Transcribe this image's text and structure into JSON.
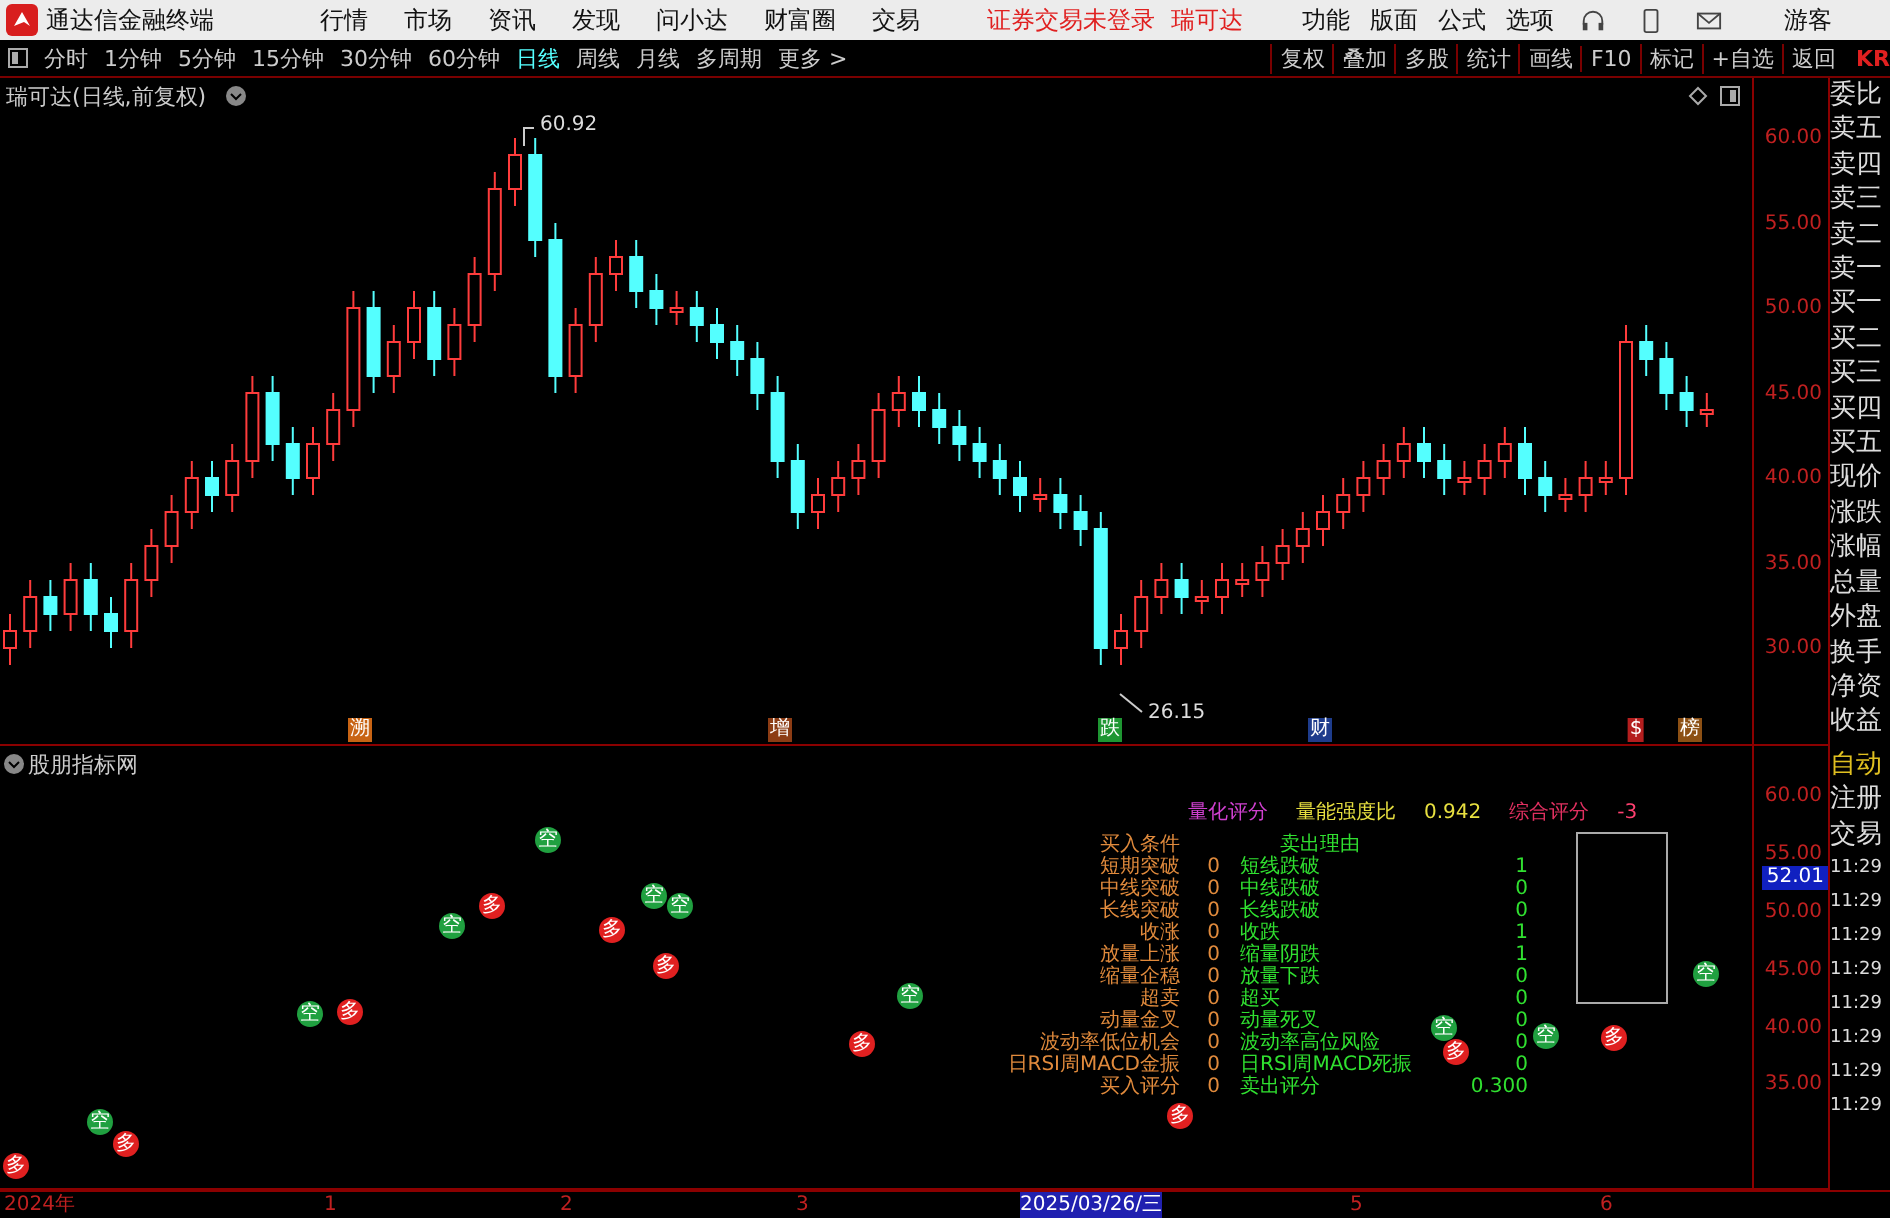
{
  "menu_bar": {
    "app_title": "通达信金融终端",
    "items": [
      "行情",
      "市场",
      "资讯",
      "发现",
      "问小达",
      "财富圈",
      "交易"
    ],
    "notice": "证券交易未登录",
    "stock_name": "瑞可达",
    "right_items": [
      "功能",
      "版面",
      "公式",
      "选项"
    ],
    "user": "游客"
  },
  "toolbar": {
    "periods": [
      {
        "label": "分时",
        "selected": false
      },
      {
        "label": "1分钟",
        "selected": false
      },
      {
        "label": "5分钟",
        "selected": false
      },
      {
        "label": "15分钟",
        "selected": false
      },
      {
        "label": "30分钟",
        "selected": false
      },
      {
        "label": "60分钟",
        "selected": false
      },
      {
        "label": "日线",
        "selected": true
      },
      {
        "label": "周线",
        "selected": false
      },
      {
        "label": "月线",
        "selected": false
      },
      {
        "label": "多周期",
        "selected": false
      },
      {
        "label": "更多 >",
        "selected": false
      }
    ],
    "tools": [
      "复权",
      "叠加",
      "多股",
      "统计",
      "画线",
      "F10",
      "标记",
      "+自选",
      "返回"
    ],
    "edge_text": "KR"
  },
  "price_chart": {
    "title": "瑞可达(日线,前复权)",
    "high_label": "60.92",
    "low_label": "26.15",
    "axis": [
      "60.00",
      "55.00",
      "50.00",
      "45.00",
      "40.00",
      "35.00",
      "30.00"
    ],
    "events": [
      {
        "label": "溯",
        "color": "#c86414"
      },
      {
        "label": "增",
        "color": "#8c3c14"
      },
      {
        "label": "跌",
        "color": "#1e9632"
      },
      {
        "label": "财",
        "color": "#1e3c8c"
      },
      {
        "label": "$",
        "color": "#b41e1e"
      },
      {
        "label": "榜",
        "color": "#8c5014"
      }
    ]
  },
  "indicator": {
    "title": "股朋指标网",
    "axis": [
      "60.00",
      "55.00",
      "50.00",
      "45.00",
      "40.00",
      "35.00"
    ],
    "current_value": "52.01",
    "summary": [
      {
        "text": "量化评分",
        "color": "#d040d0"
      },
      {
        "text": "量能强度比",
        "color": "#e8e040"
      },
      {
        "text": "0.942",
        "color": "#e8e040"
      },
      {
        "text": "综合评分",
        "color": "#e03060"
      },
      {
        "text": "-3",
        "color": "#ff4070"
      }
    ],
    "buy_title": "买入条件",
    "sell_title": "卖出理由",
    "buy_conditions": [
      {
        "label": "短期突破",
        "value": "0"
      },
      {
        "label": "中线突破",
        "value": "0"
      },
      {
        "label": "长线突破",
        "value": "0"
      },
      {
        "label": "收涨",
        "value": "0"
      },
      {
        "label": "放量上涨",
        "value": "0"
      },
      {
        "label": "缩量企稳",
        "value": "0"
      },
      {
        "label": "超卖",
        "value": "0"
      },
      {
        "label": "动量金叉",
        "value": "0"
      },
      {
        "label": "波动率低位机会",
        "value": "0"
      },
      {
        "label": "日RSI周MACD金振",
        "value": "0"
      },
      {
        "label": "买入评分",
        "value": "0"
      }
    ],
    "sell_reasons": [
      {
        "label": "短线跌破",
        "value": "1"
      },
      {
        "label": "中线跌破",
        "value": "0"
      },
      {
        "label": "长线跌破",
        "value": "0"
      },
      {
        "label": "收跌",
        "value": "1"
      },
      {
        "label": "缩量阴跌",
        "value": "1"
      },
      {
        "label": "放量下跌",
        "value": "0"
      },
      {
        "label": "超买",
        "value": "0"
      },
      {
        "label": "动量死叉",
        "value": "0"
      },
      {
        "label": "波动率高位风险",
        "value": "0"
      },
      {
        "label": "日RSI周MACD死振",
        "value": "0"
      },
      {
        "label": "卖出评分",
        "value": "0.300"
      }
    ],
    "dots": [
      {
        "label": "多",
        "color": "#e02020"
      },
      {
        "label": "空",
        "color": "#20a040"
      },
      {
        "label": "多",
        "color": "#e02020"
      },
      {
        "label": "空",
        "color": "#20a040"
      },
      {
        "label": "多",
        "color": "#e02020"
      },
      {
        "label": "空",
        "color": "#20a040"
      },
      {
        "label": "多",
        "color": "#e02020"
      },
      {
        "label": "空",
        "color": "#20a040"
      },
      {
        "label": "多",
        "color": "#e02020"
      },
      {
        "label": "空",
        "color": "#20a040"
      },
      {
        "label": "多",
        "color": "#e02020"
      },
      {
        "label": "空",
        "color": "#20a040"
      },
      {
        "label": "多",
        "color": "#e02020"
      },
      {
        "label": "空",
        "color": "#20a040"
      },
      {
        "label": "多",
        "color": "#e02020"
      },
      {
        "label": "空",
        "color": "#20a040"
      },
      {
        "label": "多",
        "color": "#e02020"
      },
      {
        "label": "空",
        "color": "#20a040"
      },
      {
        "label": "多",
        "color": "#e02020"
      },
      {
        "label": "空",
        "color": "#20a040"
      }
    ]
  },
  "side_panel": {
    "quote_labels": [
      "委比",
      "卖五",
      "卖四",
      "卖三",
      "卖二",
      "卖一",
      "买一",
      "买二",
      "买三",
      "买四",
      "买五",
      "现价",
      "涨跌",
      "涨幅",
      "总量",
      "外盘",
      "换手",
      "净资",
      "收益"
    ],
    "auto_label": "自动",
    "links": [
      "注册",
      "交易"
    ],
    "times": [
      "11:29",
      "11:29",
      "11:29",
      "11:29",
      "11:29",
      "11:29",
      "11:29",
      "11:29"
    ]
  },
  "date_axis": [
    {
      "label": "2024年",
      "selected": false
    },
    {
      "label": "1",
      "selected": false
    },
    {
      "label": "2",
      "selected": false
    },
    {
      "label": "3",
      "selected": false
    },
    {
      "label": "2025/03/26/三",
      "selected": true
    },
    {
      "label": "5",
      "selected": false
    },
    {
      "label": "6",
      "selected": false
    }
  ]
}
